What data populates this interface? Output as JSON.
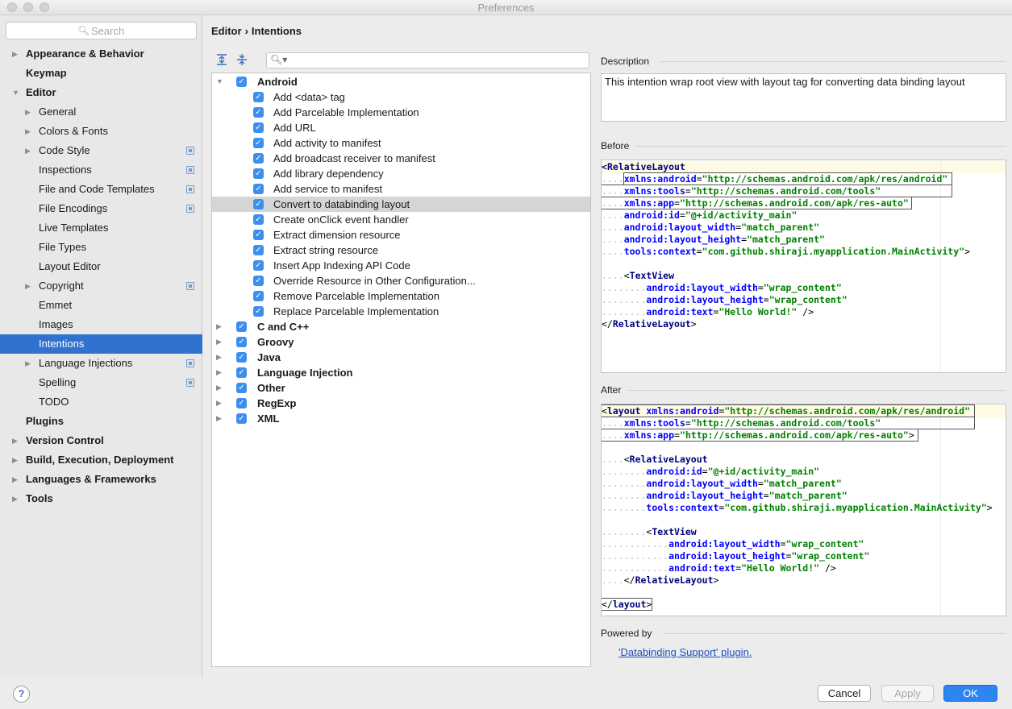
{
  "window": {
    "title": "Preferences"
  },
  "search": {
    "placeholder": "Search"
  },
  "sidebar": {
    "items": [
      {
        "label": "Appearance & Behavior",
        "bold": true,
        "level": 0,
        "arrow": true,
        "proj": false
      },
      {
        "label": "Keymap",
        "bold": true,
        "level": 0,
        "arrow": false,
        "proj": false
      },
      {
        "label": "Editor",
        "bold": true,
        "level": 0,
        "arrow": "down",
        "proj": false
      },
      {
        "label": "General",
        "bold": false,
        "level": 1,
        "arrow": true,
        "proj": false
      },
      {
        "label": "Colors & Fonts",
        "bold": false,
        "level": 1,
        "arrow": true,
        "proj": false
      },
      {
        "label": "Code Style",
        "bold": false,
        "level": 1,
        "arrow": true,
        "proj": true
      },
      {
        "label": "Inspections",
        "bold": false,
        "level": 1,
        "arrow": false,
        "proj": true
      },
      {
        "label": "File and Code Templates",
        "bold": false,
        "level": 1,
        "arrow": false,
        "proj": true
      },
      {
        "label": "File Encodings",
        "bold": false,
        "level": 1,
        "arrow": false,
        "proj": true
      },
      {
        "label": "Live Templates",
        "bold": false,
        "level": 1,
        "arrow": false,
        "proj": false
      },
      {
        "label": "File Types",
        "bold": false,
        "level": 1,
        "arrow": false,
        "proj": false
      },
      {
        "label": "Layout Editor",
        "bold": false,
        "level": 1,
        "arrow": false,
        "proj": false
      },
      {
        "label": "Copyright",
        "bold": false,
        "level": 1,
        "arrow": true,
        "proj": true
      },
      {
        "label": "Emmet",
        "bold": false,
        "level": 1,
        "arrow": false,
        "proj": false
      },
      {
        "label": "Images",
        "bold": false,
        "level": 1,
        "arrow": false,
        "proj": false
      },
      {
        "label": "Intentions",
        "bold": false,
        "level": 1,
        "arrow": false,
        "proj": false,
        "selected": true
      },
      {
        "label": "Language Injections",
        "bold": false,
        "level": 1,
        "arrow": true,
        "proj": true
      },
      {
        "label": "Spelling",
        "bold": false,
        "level": 1,
        "arrow": false,
        "proj": true
      },
      {
        "label": "TODO",
        "bold": false,
        "level": 1,
        "arrow": false,
        "proj": false
      },
      {
        "label": "Plugins",
        "bold": true,
        "level": 0,
        "arrow": false,
        "proj": false
      },
      {
        "label": "Version Control",
        "bold": true,
        "level": 0,
        "arrow": true,
        "proj": false
      },
      {
        "label": "Build, Execution, Deployment",
        "bold": true,
        "level": 0,
        "arrow": true,
        "proj": false
      },
      {
        "label": "Languages & Frameworks",
        "bold": true,
        "level": 0,
        "arrow": true,
        "proj": false
      },
      {
        "label": "Tools",
        "bold": true,
        "level": 0,
        "arrow": true,
        "proj": false
      }
    ]
  },
  "breadcrumb": {
    "parent": "Editor",
    "separator": "›",
    "current": "Intentions"
  },
  "toolbar": {
    "expand_icon": "expand-all-icon",
    "collapse_icon": "collapse-all-icon"
  },
  "tree": {
    "rows": [
      {
        "label": "Android",
        "bold": true,
        "level": 0,
        "arrow": "down",
        "checked": true
      },
      {
        "label": "Add <data> tag",
        "level": 1,
        "checked": true
      },
      {
        "label": "Add Parcelable Implementation",
        "level": 1,
        "checked": true
      },
      {
        "label": "Add URL",
        "level": 1,
        "checked": true
      },
      {
        "label": "Add activity to manifest",
        "level": 1,
        "checked": true
      },
      {
        "label": "Add broadcast receiver to manifest",
        "level": 1,
        "checked": true
      },
      {
        "label": "Add library dependency",
        "level": 1,
        "checked": true
      },
      {
        "label": "Add service to manifest",
        "level": 1,
        "checked": true
      },
      {
        "label": "Convert to databinding layout",
        "level": 1,
        "checked": true,
        "selected": true
      },
      {
        "label": "Create onClick event handler",
        "level": 1,
        "checked": true
      },
      {
        "label": "Extract dimension resource",
        "level": 1,
        "checked": true
      },
      {
        "label": "Extract string resource",
        "level": 1,
        "checked": true
      },
      {
        "label": "Insert App Indexing API Code",
        "level": 1,
        "checked": true
      },
      {
        "label": "Override Resource in Other Configuration...",
        "level": 1,
        "checked": true
      },
      {
        "label": "Remove Parcelable Implementation",
        "level": 1,
        "checked": true
      },
      {
        "label": "Replace Parcelable Implementation",
        "level": 1,
        "checked": true
      },
      {
        "label": "C and C++",
        "bold": true,
        "level": 0,
        "arrow": "right",
        "checked": true
      },
      {
        "label": "Groovy",
        "bold": true,
        "level": 0,
        "arrow": "right",
        "checked": true
      },
      {
        "label": "Java",
        "bold": true,
        "level": 0,
        "arrow": "right",
        "checked": true
      },
      {
        "label": "Language Injection",
        "bold": true,
        "level": 0,
        "arrow": "right",
        "checked": true
      },
      {
        "label": "Other",
        "bold": true,
        "level": 0,
        "arrow": "right",
        "checked": true
      },
      {
        "label": "RegExp",
        "bold": true,
        "level": 0,
        "arrow": "right",
        "checked": true
      },
      {
        "label": "XML",
        "bold": true,
        "level": 0,
        "arrow": "right",
        "checked": true
      }
    ]
  },
  "description": {
    "label": "Description",
    "text": "This intention wrap root view with layout tag for converting data binding layout"
  },
  "before": {
    "label": "Before",
    "lines": [
      [
        [
          "tag",
          "<"
        ],
        [
          "tag",
          "RelativeLayout"
        ]
      ],
      [
        [
          "dotsp",
          "    "
        ],
        [
          "attr",
          "xmlns:android"
        ],
        [
          "plain",
          "="
        ],
        [
          "val",
          "\"http://schemas.android.com/apk/res/android\""
        ]
      ],
      [
        [
          "dotsp",
          "    "
        ],
        [
          "attr",
          "xmlns:tools"
        ],
        [
          "plain",
          "="
        ],
        [
          "val",
          "\"http://schemas.android.com/tools\""
        ]
      ],
      [
        [
          "dotsp",
          "    "
        ],
        [
          "attr",
          "xmlns:app"
        ],
        [
          "plain",
          "="
        ],
        [
          "val",
          "\"http://schemas.android.com/apk/res-auto\""
        ]
      ],
      [
        [
          "dotsp",
          "    "
        ],
        [
          "attr",
          "android:id"
        ],
        [
          "plain",
          "="
        ],
        [
          "val",
          "\"@+id/activity_main\""
        ]
      ],
      [
        [
          "dotsp",
          "    "
        ],
        [
          "attr",
          "android:layout_width"
        ],
        [
          "plain",
          "="
        ],
        [
          "val",
          "\"match_parent\""
        ]
      ],
      [
        [
          "dotsp",
          "    "
        ],
        [
          "attr",
          "android:layout_height"
        ],
        [
          "plain",
          "="
        ],
        [
          "val",
          "\"match_parent\""
        ]
      ],
      [
        [
          "dotsp",
          "    "
        ],
        [
          "attr",
          "tools:context"
        ],
        [
          "plain",
          "="
        ],
        [
          "val",
          "\"com.github.shiraji.myapplication.MainActivity\""
        ],
        [
          "plain",
          ">"
        ]
      ],
      [],
      [
        [
          "dotsp",
          "    "
        ],
        [
          "plain",
          "<"
        ],
        [
          "tag",
          "TextView"
        ]
      ],
      [
        [
          "dotsp",
          "        "
        ],
        [
          "attr",
          "android:layout_width"
        ],
        [
          "plain",
          "="
        ],
        [
          "val",
          "\"wrap_content\""
        ]
      ],
      [
        [
          "dotsp",
          "        "
        ],
        [
          "attr",
          "android:layout_height"
        ],
        [
          "plain",
          "="
        ],
        [
          "val",
          "\"wrap_content\""
        ]
      ],
      [
        [
          "dotsp",
          "        "
        ],
        [
          "attr",
          "android:text"
        ],
        [
          "plain",
          "="
        ],
        [
          "val",
          "\"Hello World!\""
        ],
        [
          "plain",
          " />"
        ]
      ],
      [
        [
          "plain",
          "</"
        ],
        [
          "tag",
          "RelativeLayout"
        ],
        [
          "plain",
          ">"
        ]
      ]
    ]
  },
  "after": {
    "label": "After",
    "lines": [
      [
        [
          "plain",
          "<"
        ],
        [
          "tag",
          "layout"
        ],
        [
          "plain",
          " "
        ],
        [
          "attr",
          "xmlns:android"
        ],
        [
          "plain",
          "="
        ],
        [
          "val",
          "\"http://schemas.android.com/apk/res/android\""
        ]
      ],
      [
        [
          "dotsp",
          "    "
        ],
        [
          "attr",
          "xmlns:tools"
        ],
        [
          "plain",
          "="
        ],
        [
          "val",
          "\"http://schemas.android.com/tools\""
        ]
      ],
      [
        [
          "dotsp",
          "    "
        ],
        [
          "attr",
          "xmlns:app"
        ],
        [
          "plain",
          "="
        ],
        [
          "val",
          "\"http://schemas.android.com/apk/res-auto\""
        ],
        [
          "plain",
          ">"
        ]
      ],
      [],
      [
        [
          "dotsp",
          "    "
        ],
        [
          "plain",
          "<"
        ],
        [
          "tag",
          "RelativeLayout"
        ]
      ],
      [
        [
          "dotsp",
          "        "
        ],
        [
          "attr",
          "android:id"
        ],
        [
          "plain",
          "="
        ],
        [
          "val",
          "\"@+id/activity_main\""
        ]
      ],
      [
        [
          "dotsp",
          "        "
        ],
        [
          "attr",
          "android:layout_width"
        ],
        [
          "plain",
          "="
        ],
        [
          "val",
          "\"match_parent\""
        ]
      ],
      [
        [
          "dotsp",
          "        "
        ],
        [
          "attr",
          "android:layout_height"
        ],
        [
          "plain",
          "="
        ],
        [
          "val",
          "\"match_parent\""
        ]
      ],
      [
        [
          "dotsp",
          "        "
        ],
        [
          "attr",
          "tools:context"
        ],
        [
          "plain",
          "="
        ],
        [
          "val",
          "\"com.github.shiraji.myapplication.MainActivity\""
        ],
        [
          "plain",
          ">"
        ]
      ],
      [],
      [
        [
          "dotsp",
          "        "
        ],
        [
          "plain",
          "<"
        ],
        [
          "tag",
          "TextView"
        ]
      ],
      [
        [
          "dotsp",
          "            "
        ],
        [
          "attr",
          "android:layout_width"
        ],
        [
          "plain",
          "="
        ],
        [
          "val",
          "\"wrap_content\""
        ]
      ],
      [
        [
          "dotsp",
          "            "
        ],
        [
          "attr",
          "android:layout_height"
        ],
        [
          "plain",
          "="
        ],
        [
          "val",
          "\"wrap_content\""
        ]
      ],
      [
        [
          "dotsp",
          "            "
        ],
        [
          "attr",
          "android:text"
        ],
        [
          "plain",
          "="
        ],
        [
          "val",
          "\"Hello World!\""
        ],
        [
          "plain",
          " />"
        ]
      ],
      [
        [
          "dotsp",
          "    "
        ],
        [
          "plain",
          "</"
        ],
        [
          "tag",
          "RelativeLayout"
        ],
        [
          "plain",
          ">"
        ]
      ],
      [],
      [
        [
          "plain",
          "</"
        ],
        [
          "tag",
          "layout"
        ],
        [
          "plain",
          ">"
        ]
      ]
    ]
  },
  "powered_by": {
    "label": "Powered by",
    "link": "'Databinding Support' plugin."
  },
  "buttons": {
    "help": "?",
    "cancel": "Cancel",
    "apply": "Apply",
    "ok": "OK"
  },
  "colors": {
    "selection": "#2f72cf",
    "checkbox": "#3c8ff0",
    "ok_button": "#2c85f0",
    "link": "#2050c0"
  }
}
